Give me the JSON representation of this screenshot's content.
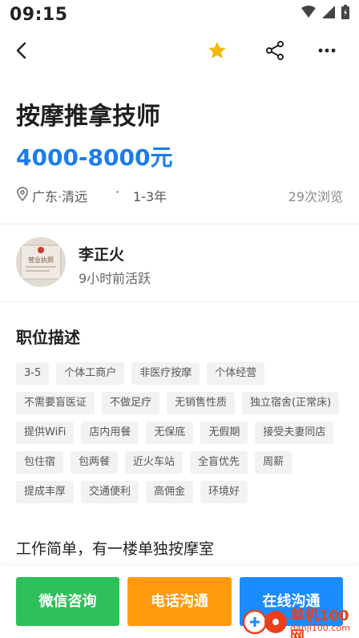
{
  "status_bar": {
    "time": "09:15"
  },
  "job": {
    "title": "按摩推拿技师",
    "salary": "4000-8000元",
    "location": "广东·清远",
    "separator": "·",
    "experience": "1-3年",
    "views": "29次浏览"
  },
  "recruiter": {
    "name": "李正火",
    "active_status": "9小时前活跃",
    "avatar_text": "营业执照"
  },
  "description": {
    "section_title": "职位描述",
    "tags": [
      "3-5",
      "个体工商户",
      "非医疗按摩",
      "个体经营",
      "不需要盲医证",
      "不做足疗",
      "无销售性质",
      "独立宿舍(正常床)",
      "提供WiFi",
      "店内用餐",
      "无保底",
      "无假期",
      "接受夫妻同店",
      "包住宿",
      "包两餐",
      "近火车站",
      "全盲优先",
      "周薪",
      "提成丰厚",
      "交通便利",
      "高佣金",
      "环境好"
    ],
    "text": "工作简单，有一楼单独按摩室"
  },
  "actions": {
    "wechat_label": "微信咨询",
    "phone_label": "电话沟通",
    "online_label": "在线沟通"
  },
  "watermark": {
    "brand": "单机100网",
    "url": "danji100.com"
  },
  "colors": {
    "accent": "#1a7cf0",
    "wechat": "#2ec05a",
    "phone": "#ff9a0c",
    "online": "#1a8cff",
    "star": "#f5b70a"
  }
}
